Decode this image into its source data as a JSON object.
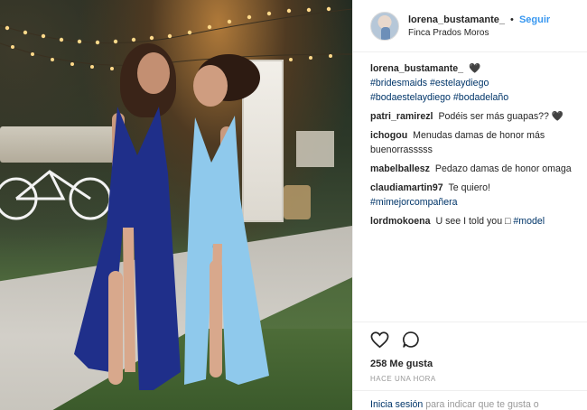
{
  "header": {
    "username": "lorena_bustamante_",
    "separator": "•",
    "follow_label": "Seguir",
    "location": "Finca Prados Moros"
  },
  "caption": {
    "username": "lorena_bustamante_",
    "heart": "🖤",
    "hashtags": [
      "#bridesmaids",
      "#estelaydiego",
      "#bodaestelaydiego",
      "#bodadelaño"
    ]
  },
  "comments": [
    {
      "username": "patri_ramirezl",
      "text": "Podéis ser más guapas?? 🖤"
    },
    {
      "username": "ichogou",
      "text": "Menudas damas de honor más buenorrasssss"
    },
    {
      "username": "mabelballesz",
      "text": "Pedazo damas de honor omaga"
    },
    {
      "username": "claudiamartin97",
      "text": "Te quiero!",
      "tag": "#mimejorcompañera"
    },
    {
      "username": "lordmokoena",
      "text": "U see I told you □",
      "tag": "#model"
    }
  ],
  "actions": {
    "like_icon": "heart-outline-icon",
    "comment_icon": "comment-bubble-icon",
    "likes": "258 Me gusta",
    "time": "HACE UNA HORA"
  },
  "login": {
    "link": "Inicia sesión",
    "rest": "para indicar que te gusta o"
  },
  "colors": {
    "link_blue": "#3897f0",
    "hashtag": "#003569",
    "navy_dress": "#1f2f8a",
    "light_blue_dress": "#8fc9ec"
  }
}
